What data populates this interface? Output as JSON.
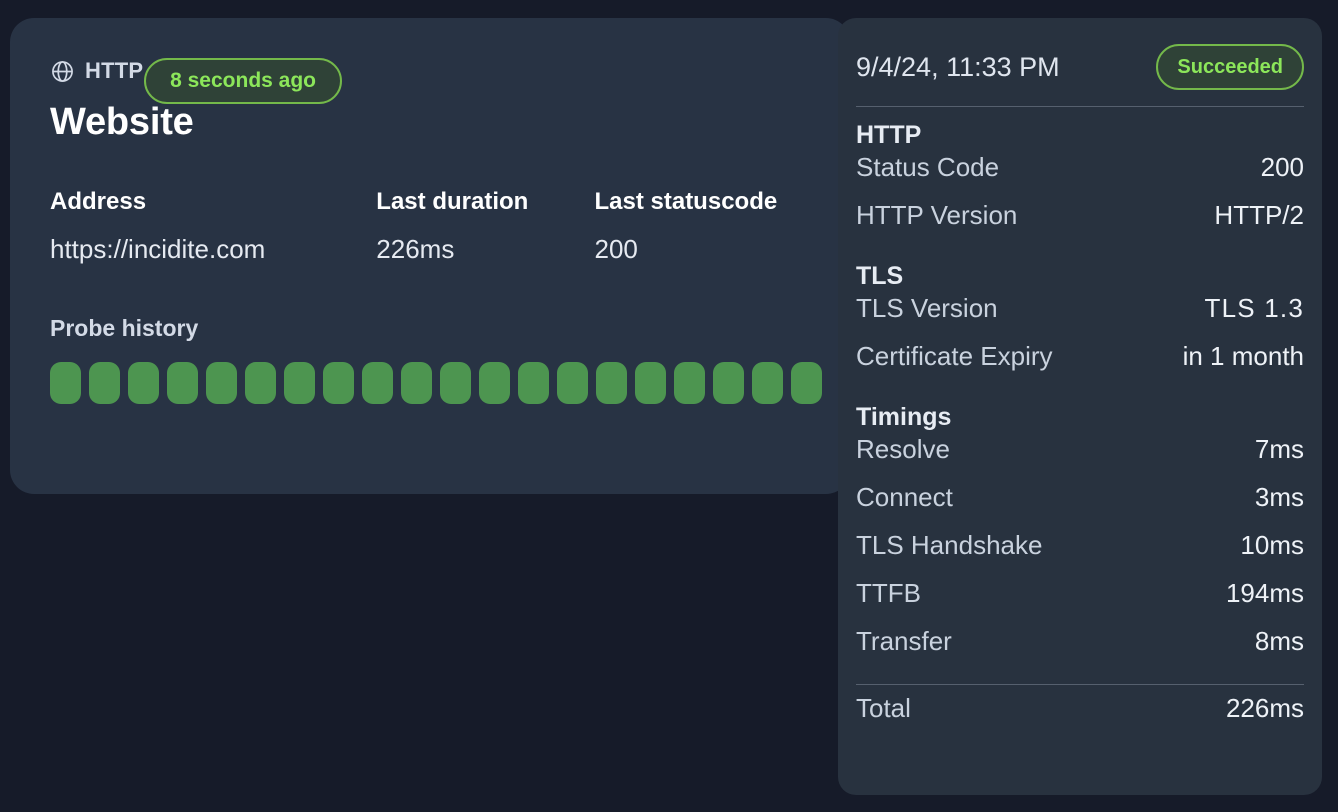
{
  "colors": {
    "page_background": "#161b29",
    "card_background": "#283344",
    "panel_background": "#28323f",
    "accent_green": "#8ce65a",
    "badge_border": "#74b94a",
    "badge_fill": "#2f4237",
    "probe_ok": "#4d9550"
  },
  "monitor": {
    "protocol_icon": "globe-icon",
    "protocol": "HTTP",
    "name": "Website",
    "time_badge": "8 seconds ago",
    "stats": [
      {
        "label": "Address",
        "value": "https://incidite.com"
      },
      {
        "label": "Last duration",
        "value": "226ms"
      },
      {
        "label": "Last statuscode",
        "value": "200"
      }
    ],
    "probe_history": {
      "heading": "Probe history",
      "bars": [
        "ok",
        "ok",
        "ok",
        "ok",
        "ok",
        "ok",
        "ok",
        "ok",
        "ok",
        "ok",
        "ok",
        "ok",
        "ok",
        "ok",
        "ok",
        "ok",
        "ok",
        "ok",
        "ok",
        "ok"
      ]
    }
  },
  "detail": {
    "timestamp": "9/4/24, 11:33 PM",
    "status": "Succeeded",
    "sections": [
      {
        "title": "HTTP",
        "rows": [
          {
            "key": "Status Code",
            "value": "200"
          },
          {
            "key": "HTTP Version",
            "value": "HTTP/2"
          }
        ]
      },
      {
        "title": "TLS",
        "rows": [
          {
            "key": "TLS Version",
            "value": "TLS 1.3"
          },
          {
            "key": "Certificate Expiry",
            "value": "in 1 month"
          }
        ]
      },
      {
        "title": "Timings",
        "rows": [
          {
            "key": "Resolve",
            "value": "7ms"
          },
          {
            "key": "Connect",
            "value": "3ms"
          },
          {
            "key": "TLS Handshake",
            "value": "10ms"
          },
          {
            "key": "TTFB",
            "value": "194ms"
          },
          {
            "key": "Transfer",
            "value": "8ms"
          }
        ]
      }
    ],
    "total": {
      "key": "Total",
      "value": "226ms"
    }
  }
}
